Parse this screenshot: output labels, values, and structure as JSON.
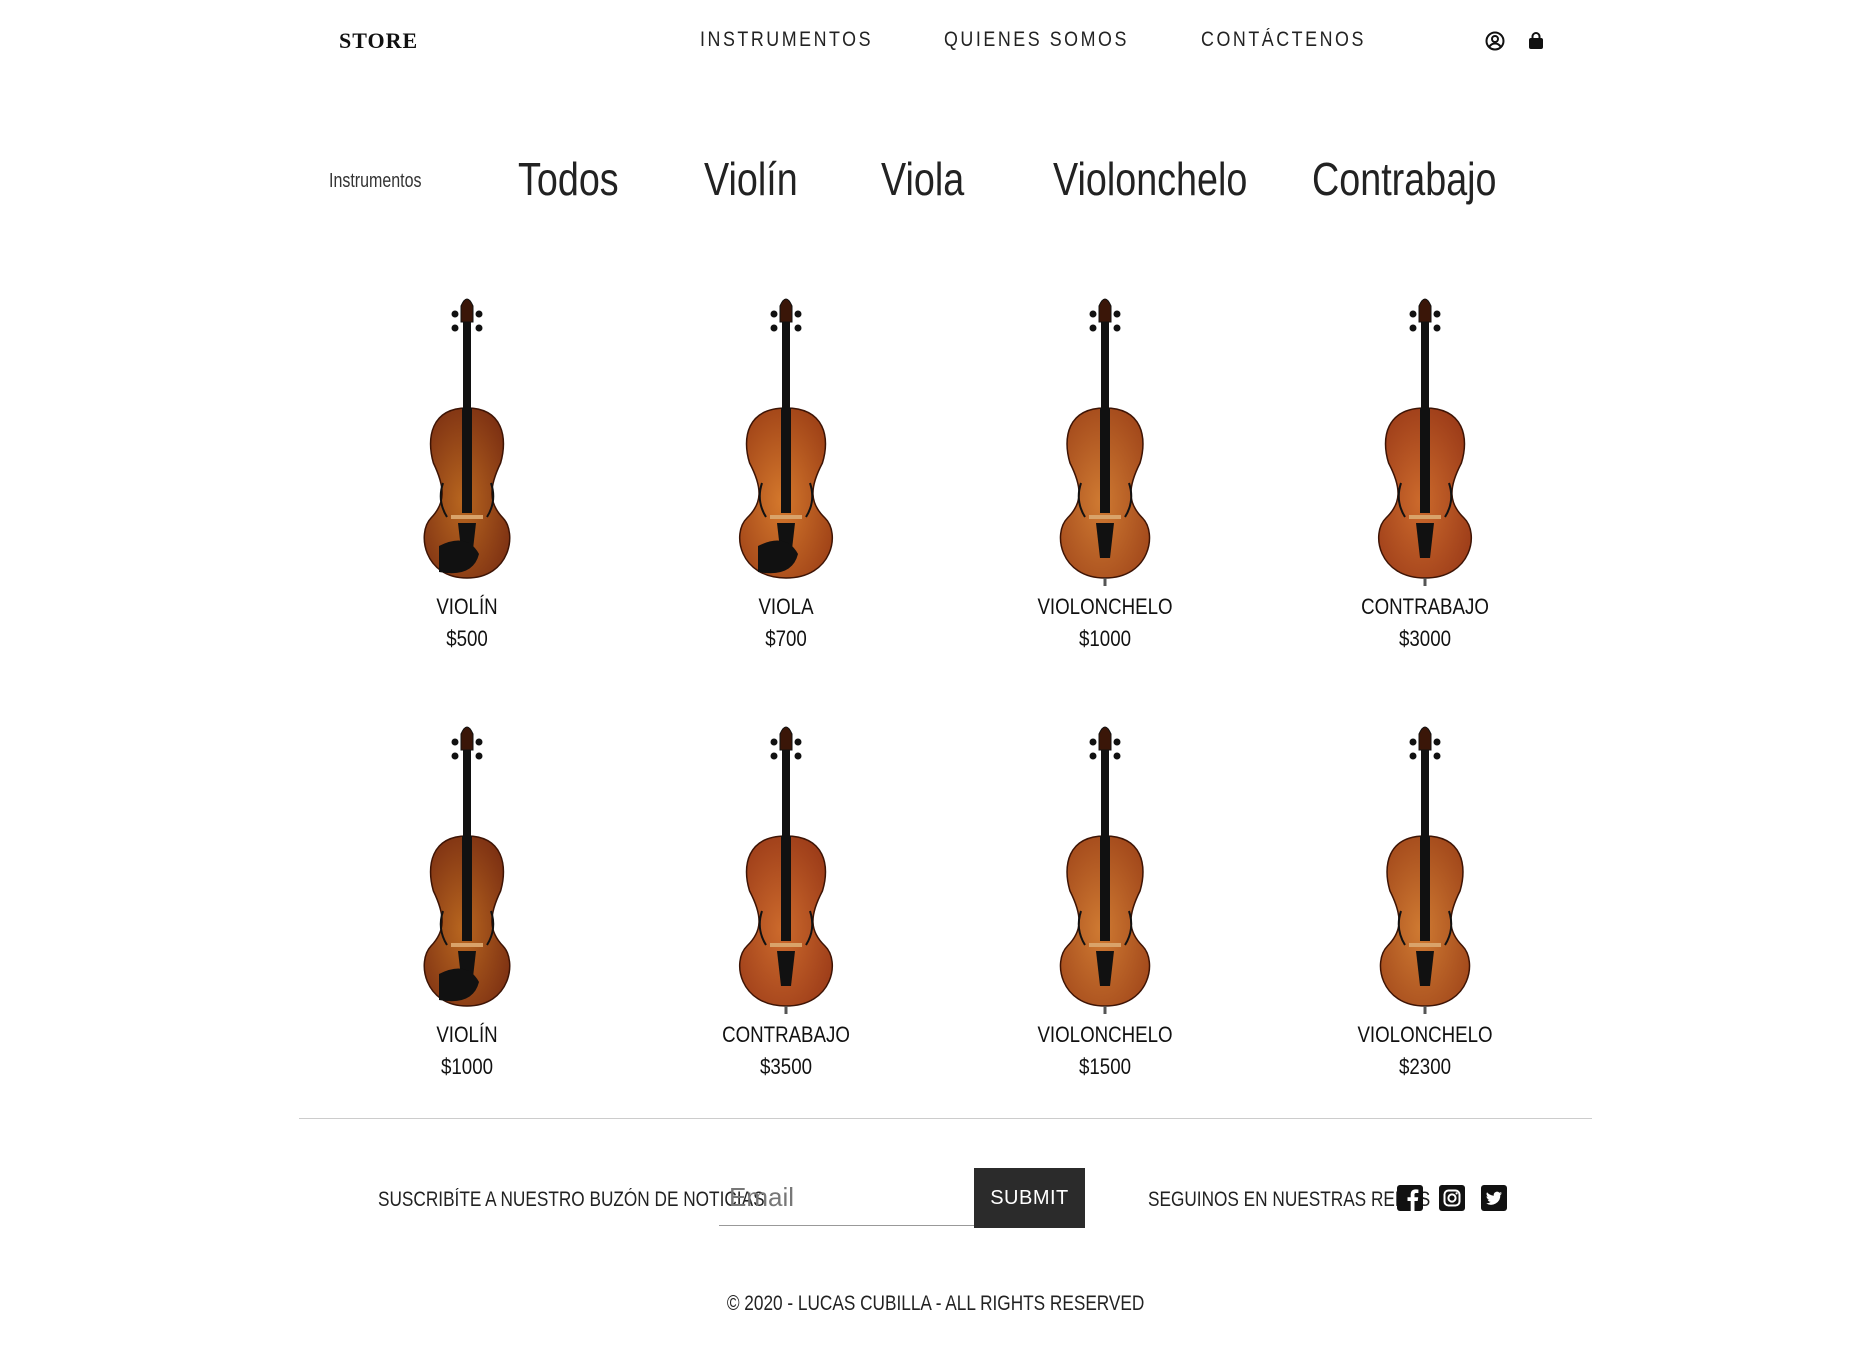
{
  "header": {
    "logo": "STORE",
    "nav": [
      "INSTRUMENTOS",
      "QUIENES SOMOS",
      "CONTÁCTENOS"
    ]
  },
  "filter": {
    "label": "Instrumentos",
    "options": [
      "Todos",
      "Violín",
      "Viola",
      "Violonchelo",
      "Contrabajo"
    ]
  },
  "products": [
    {
      "name": "VIOLÍN",
      "price": "$500",
      "kind": "violin"
    },
    {
      "name": "VIOLA",
      "price": "$700",
      "kind": "viola"
    },
    {
      "name": "VIOLONCHELO",
      "price": "$1000",
      "kind": "cello"
    },
    {
      "name": "CONTRABAJO",
      "price": "$3000",
      "kind": "bass"
    },
    {
      "name": "VIOLÍN",
      "price": "$1000",
      "kind": "violin"
    },
    {
      "name": "CONTRABAJO",
      "price": "$3500",
      "kind": "bass"
    },
    {
      "name": "VIOLONCHELO",
      "price": "$1500",
      "kind": "cello"
    },
    {
      "name": "VIOLONCHELO",
      "price": "$2300",
      "kind": "cello"
    }
  ],
  "footer": {
    "subscribe_label": "SUSCRIBÍTE A NUESTRO BUZÓN DE NOTICIAS",
    "email_placeholder": "Email",
    "submit_label": "SUBMIT",
    "social_label": "SEGUINOS EN NUESTRAS REDES",
    "socials": [
      "facebook-icon",
      "instagram-icon",
      "twitter-icon"
    ],
    "copyright": "© 2020 - LUCAS CUBILLA - ALL RIGHTS RESERVED"
  }
}
